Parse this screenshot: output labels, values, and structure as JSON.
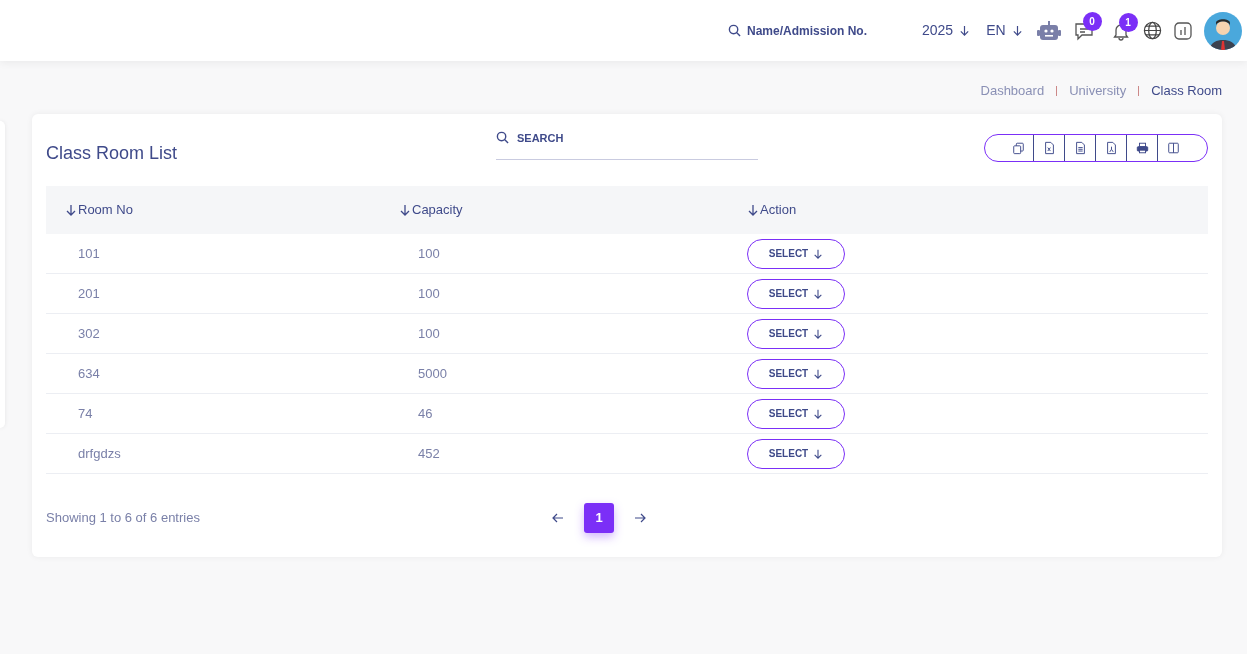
{
  "header": {
    "search": {
      "placeholder": "Name/Admission No."
    },
    "year": "2025",
    "language": "EN",
    "messages_count": "0",
    "notifications_count": "1"
  },
  "breadcrumb": [
    {
      "label": "Dashboard",
      "current": false
    },
    {
      "label": "University",
      "current": false
    },
    {
      "label": "Class Room",
      "current": true
    }
  ],
  "card": {
    "title": "Class Room List",
    "search": {
      "placeholder": "SEARCH"
    },
    "export_buttons": [
      {
        "kind": "copy"
      },
      {
        "kind": "excel"
      },
      {
        "kind": "csv"
      },
      {
        "kind": "pdf"
      },
      {
        "kind": "print"
      },
      {
        "kind": "columns"
      }
    ],
    "table": {
      "columns": [
        "Room No",
        "Capacity",
        "Action"
      ],
      "rows": [
        {
          "room_no": "101",
          "capacity": "100",
          "action": "SELECT"
        },
        {
          "room_no": "201",
          "capacity": "100",
          "action": "SELECT"
        },
        {
          "room_no": "302",
          "capacity": "100",
          "action": "SELECT"
        },
        {
          "room_no": "634",
          "capacity": "5000",
          "action": "SELECT"
        },
        {
          "room_no": "74",
          "capacity": "46",
          "action": "SELECT"
        },
        {
          "room_no": "drfgdzs",
          "capacity": "452",
          "action": "SELECT"
        }
      ]
    },
    "footer": {
      "info": "Showing 1 to 6 of 6 entries",
      "pages": [
        {
          "label": "1",
          "selected": true
        }
      ]
    }
  }
}
